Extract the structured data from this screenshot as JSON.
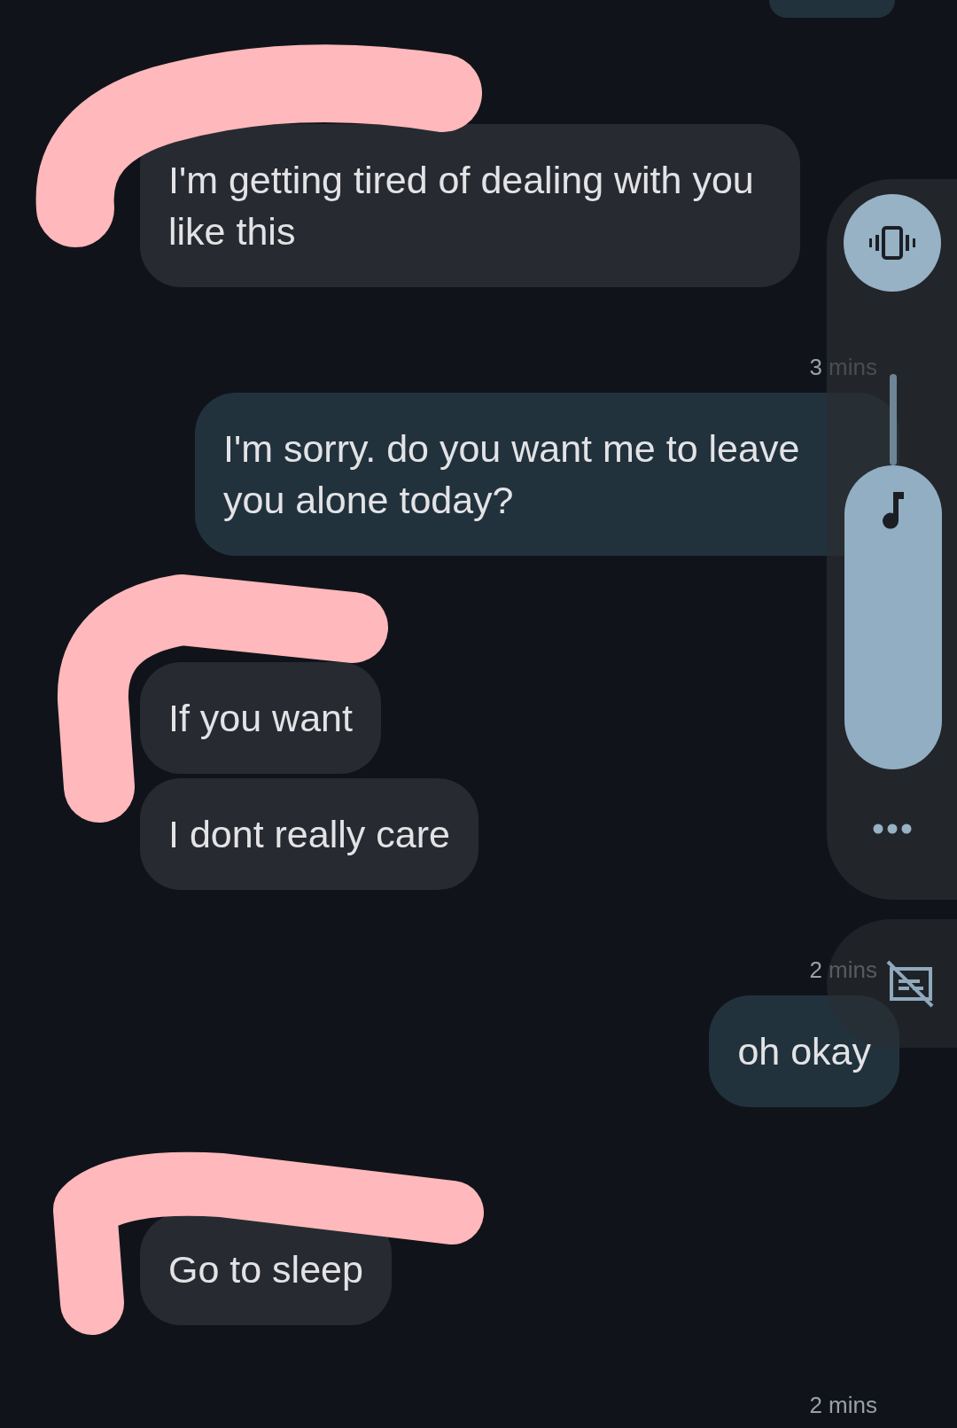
{
  "messages": [
    {
      "kind": "clipped"
    },
    {
      "kind": "received",
      "text": "I'm getting tired of dealing with you like this"
    },
    {
      "kind": "time",
      "text": "3 mins"
    },
    {
      "kind": "sent",
      "text": "I'm sorry. do you want me to leave you alone today?"
    },
    {
      "kind": "received",
      "text": "If you want"
    },
    {
      "kind": "received",
      "text": "I dont really care"
    },
    {
      "kind": "time",
      "text": "2 mins"
    },
    {
      "kind": "sent",
      "text": "oh okay"
    },
    {
      "kind": "received",
      "text": "Go to sleep"
    },
    {
      "kind": "time",
      "text": "2 mins"
    }
  ],
  "volume_panel": {
    "level": 0.77
  }
}
